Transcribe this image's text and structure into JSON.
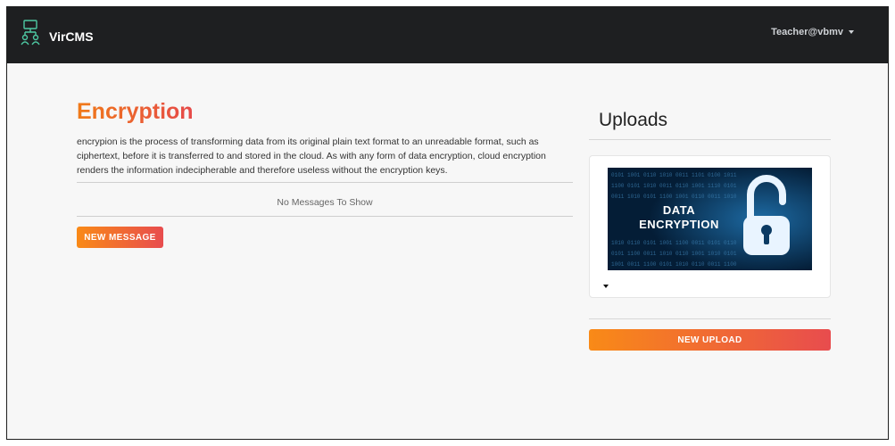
{
  "navbar": {
    "brand": "VirCMS",
    "user": "Teacher@vbmv"
  },
  "main": {
    "title": "Encryption",
    "description": "encrypion is the process of transforming data from its original plain text format to an unreadable format, such as ciphertext, before it is transferred to and stored in the cloud. As with any form of data encryption, cloud encryption renders the information indecipherable and therefore useless without the encryption keys.",
    "empty_messages": "No Messages To Show",
    "new_message_label": "NEW MESSAGE"
  },
  "uploads": {
    "title": "Uploads",
    "thumbnail_text_line1": "DATA",
    "thumbnail_text_line2": "ENCRYPTION",
    "new_upload_label": "NEW UPLOAD"
  },
  "colors": {
    "navbar_bg": "#1e1f21",
    "accent_start": "#f98a17",
    "accent_end": "#e84c4e",
    "brand_icon": "#4ec9a3"
  },
  "icons": {
    "brand": "network-users-icon",
    "user_menu": "caret-down-icon",
    "thumbnail": "padlock-icon",
    "card_toggle": "caret-down-icon"
  }
}
